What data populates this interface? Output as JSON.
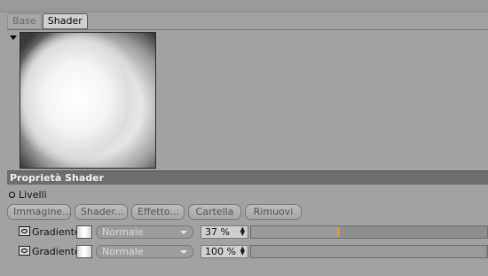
{
  "tabs": [
    {
      "label": "Base",
      "active": false
    },
    {
      "label": "Shader",
      "active": true
    }
  ],
  "section": {
    "title": "Proprietà Shader"
  },
  "livelli": {
    "label": "Livelli"
  },
  "buttons": [
    "Immagine...",
    "Shader...",
    "Effetto...",
    "Cartella",
    "Rimuovi"
  ],
  "layers": [
    {
      "name": "Gradiente",
      "mode": "Normale",
      "opacity_text": "37 %",
      "opacity": 0.37
    },
    {
      "name": "Gradiente",
      "mode": "Normale",
      "opacity_text": "100 %",
      "opacity": 1.0
    }
  ],
  "colors": {
    "accent": "#e09a20",
    "header": "#6e6e6e",
    "panel": "#a2a2a2"
  },
  "icons": [
    "eye-icon",
    "collapse-arrow-icon",
    "dropdown-arrow-icon",
    "spinner-arrows-icon"
  ]
}
